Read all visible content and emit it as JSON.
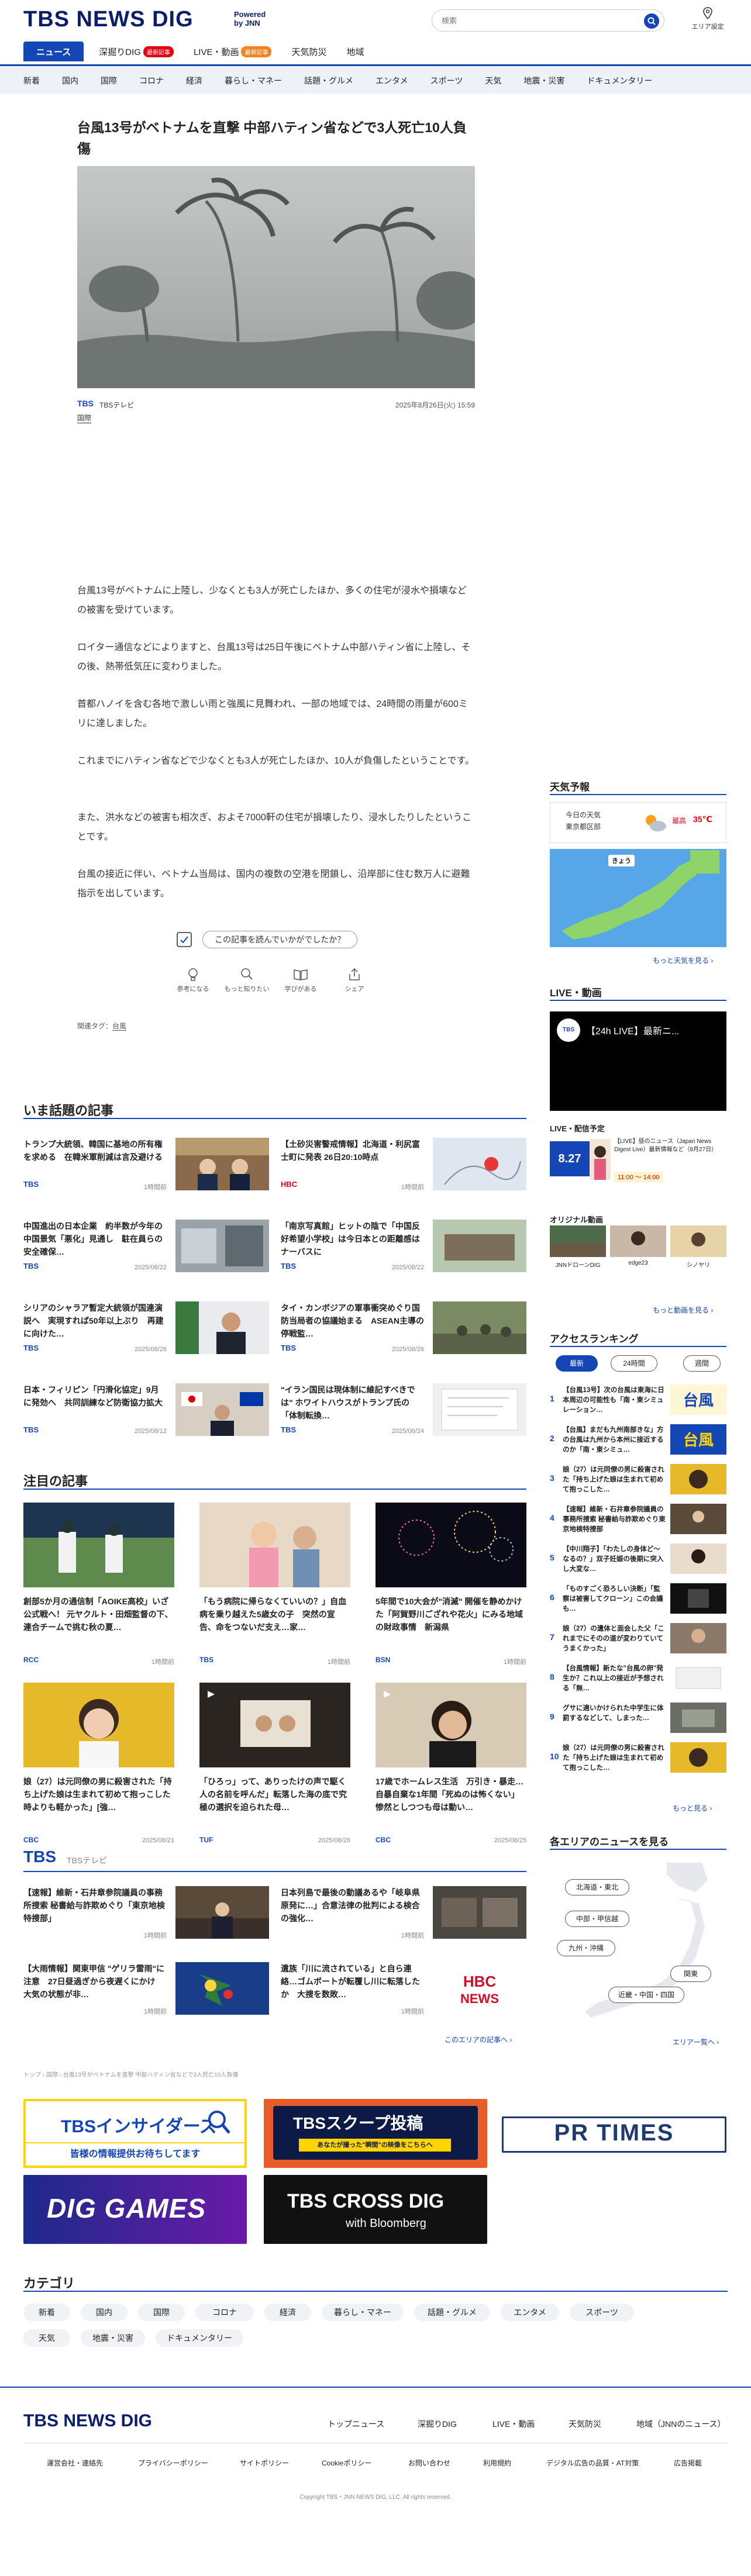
{
  "header": {
    "logo": "TBS NEWS DIG",
    "powered_line1": "Powered",
    "powered_line2": "by JNN",
    "search_placeholder": "検索",
    "area_label": "エリア設定",
    "nav": [
      {
        "label": "ニュース",
        "badge": ""
      },
      {
        "label": "深掘りDIG",
        "badge": "最新記事"
      },
      {
        "label": "LIVE・動画",
        "badge": "最新記事"
      },
      {
        "label": "天気防災",
        "badge": ""
      },
      {
        "label": "地域",
        "badge": ""
      }
    ],
    "subnav": [
      "新着",
      "国内",
      "国際",
      "コロナ",
      "経済",
      "暮らし・マネー",
      "話題・グルメ",
      "エンタメ",
      "スポーツ",
      "天気",
      "地震・災害",
      "ドキュメンタリー"
    ]
  },
  "article": {
    "title": "台風13号がベトナムを直撃 中部ハティン省などで3人死亡10人負傷",
    "source_logo": "TBS",
    "source_name": "TBSテレビ",
    "date": "2025年8月26日(火) 15:59",
    "category": "国際",
    "paragraphs": [
      "台風13号がベトナムに上陸し、少なくとも3人が死亡したほか、多くの住宅が浸水や損壊などの被害を受けています。",
      "ロイター通信などによりますと、台風13号は25日午後にベトナム中部ハティン省に上陸し、その後、熱帯低気圧に変わりました。",
      "首都ハノイを含む各地で激しい雨と強風に見舞われ、一部の地域では、24時間の雨量が600ミリに達しました。",
      "これまでにハティン省などで少なくとも3人が死亡したほか、10人が負傷したということです。",
      "また、洪水などの被害も相次ぎ、およそ7000軒の住宅が損壊したり、浸水したりしたということです。",
      "台風の接近に伴い、ベトナム当局は、国内の複数の空港を閉鎖し、沿岸部に住む数万人に避難指示を出しています。"
    ],
    "feedback_question": "この記事を読んでいかがでしたか？",
    "reactions": [
      "参考になる",
      "もっと知りたい",
      "学びがある",
      "シェア"
    ],
    "tags_label": "関連タグ：",
    "tag": "台風"
  },
  "trending": {
    "heading": "いま話題の記事",
    "items": [
      {
        "title": "トランプ大統領、韓国に基地の所有権を求める　在韓米軍削減は言及避ける",
        "src": "TBS",
        "time": "1時間前"
      },
      {
        "title": "【土砂災害警戒情報】北海道・利尻富士町に発表 26日20:10時点",
        "src": "HBC",
        "time": "1時間前"
      },
      {
        "title": "中国進出の日本企業　約半数が今年の中国景気「悪化」見通し　駐在員らの安全確保…",
        "src": "TBS",
        "time": "2025/08/22"
      },
      {
        "title": "「南京写真館」ヒットの陰で「中国反好希望小学校」は今日本との距離感はナーバスに",
        "src": "TBS",
        "time": "2025/08/22"
      },
      {
        "title": "シリアのシャラア暫定大統領が国連演説へ　実現すれば50年以上ぶり　再建に向けた…",
        "src": "TBS",
        "time": "2025/08/26"
      },
      {
        "title": "タイ・カンボジアの軍事衝突めぐり国防当局者の協議始まる　ASEAN主導の停戦監…",
        "src": "TBS",
        "time": "2025/08/26"
      },
      {
        "title": "日本・フィリピン「円滑化協定」9月に発効へ　共同訓練など防衛協力拡大",
        "src": "TBS",
        "time": "2025/08/12"
      },
      {
        "title": "\"イラン国民は現体制に維記すべきでは\" ホワイトハウスがトランプ氏の「体制転換…",
        "src": "TBS",
        "time": "2025/06/24"
      }
    ]
  },
  "attention": {
    "heading": "注目の記事",
    "items": [
      {
        "title": "創部5か月の通信制「AOIKE高校」いざ公式戦へ！ 元ヤクルト・田畑監督の下、連合チームで挑む秋の夏…",
        "src": "RCC",
        "time": "1時間前"
      },
      {
        "title": "「もう病院に帰らなくていいの？」自血病を乗り越えた5歳女の子　突然の宣告、命をつないだ支え…家…",
        "src": "TBS",
        "time": "1時間前"
      },
      {
        "title": "5年間で10大会が\"消滅\" 開催を静めかけた「阿賀野川ござれや花火」にみる地域の財政事情　新潟県",
        "src": "BSN",
        "time": "1時間前"
      },
      {
        "title": "娘（27）は元同僚の男に殺害された「持ち上げた娘は生まれて初めて抱っこした時よりも軽かった」[強…",
        "src": "CBC",
        "time": "2025/08/21"
      },
      {
        "title": "「ひろっ」って、ありったけの声で駆く人の名前を呼んだ」転落した海の底で究極の選択を迫られた母…",
        "src": "TUF",
        "time": "2025/08/26"
      },
      {
        "title": "17歳でホームレス生活　万引き・暴走…自暴自棄な1年間「死ぬのは怖くない」惨然としつつも母は動い…",
        "src": "CBC",
        "time": "2025/08/25"
      }
    ]
  },
  "tbs_section": {
    "logo": "TBS",
    "name": "TBSテレビ",
    "items": [
      {
        "title": "【速報】維新・石井章参院議員の事務所捜索 秘書給与詐欺めぐり「東京地検特捜部」",
        "time": "1時間前"
      },
      {
        "title": "日本列島で最後の動議あるや「岐阜県原発に…」合意法律の批判による検合の強化…",
        "time": "1時間前"
      },
      {
        "title": "【大雨情報】関東甲信 \"ゲリラ雷雨\"に注意　27日昼過ぎから夜遅くにかけ　大気の状態が非…",
        "time": "1時間前"
      },
      {
        "title": "遺族「川に流されている」と自ら連絡…ゴムボートが転覆し川に転落したか　大捜を数敗…",
        "time": "1時間前"
      }
    ],
    "more": "このエリアの記事へ ›"
  },
  "breadcrumb": "トップ › 国際 › 台風13号がベトナムを直撃 中部ハティン省などで3人死亡10人負傷",
  "banners": [
    {
      "title": "TBSインサイダーズ",
      "sub": "皆様の情報提供お待ちしてます"
    },
    {
      "title": "TBSスクープ投稿",
      "sub": "あなたが撮った\"瞬間\"の映像をこちらへ"
    },
    {
      "title": "PR TIMES",
      "sub": ""
    },
    {
      "title": "DIG GAMES",
      "sub": ""
    },
    {
      "title": "TBS CROSS DIG",
      "sub": "with Bloomberg"
    }
  ],
  "categories": {
    "heading": "カテゴリ",
    "items": [
      "新着",
      "国内",
      "国際",
      "コロナ",
      "経済",
      "暮らし・マネー",
      "話題・グルメ",
      "エンタメ",
      "スポーツ",
      "天気",
      "地震・災害",
      "ドキュメンタリー"
    ]
  },
  "sidebar": {
    "weather": {
      "heading": "天気予報",
      "today": "今日の天気",
      "region": "東京都区部",
      "high_label": "最高",
      "high": "35℃",
      "today_tag": "きょう",
      "more": "もっと天気を見る ›"
    },
    "live": {
      "heading": "LIVE・動画",
      "video_title": "【24h LIVE】最新ニ...",
      "schedule_heading": "LIVE・配信予定",
      "sched_date": "8.27",
      "sched_title": "【LIVE】昼のニュース（Japan News Digest Live）最新情報など（8月27日）",
      "sched_time": "11:00 〜 14:00",
      "original_heading": "オリジナル動画",
      "originals": [
        "JNNドローンDIG",
        "edge23",
        "シノヤリ"
      ],
      "more": "もっと動画を見る ›"
    },
    "ranking": {
      "heading": "アクセスランキング",
      "tabs": [
        "最新",
        "24時間",
        "週間"
      ],
      "items": [
        "【台風13号】次の台風は東海に日本周辺の可能性も「南・東シミュレーション…",
        "【台風】まだも九州南部きな」方の台風は九州から本州に接近するのか「南・東シミュ…",
        "娘（27）は元同僚の男に殺害された「持ち上げた娘は生まれて初めて抱っこした…",
        "【速報】維新・石井章参院議員の事務所捜索 秘書給与詐欺めぐり東京地検特捜部",
        "【中川翔子】「わたしの身体ど〜なるの？」双子妊娠の後期に突入し大変な…",
        "「ものすごく恐ろしい決断」「監察は被害してクローン」この会議も…",
        "娘（27）の遺体と面会した父「これまでにそのの道が変わりていてうまくかった」",
        "【台風情報】新たな\"台風の卵\"発生か？これ以上の接近が予想される「無…",
        "グサに適いかけられた中学生に体罰するなどして、しまった…",
        "娘（27）は元同僚の男に殺害された「持ち上げた娘は生まれて初めて抱っこした…"
      ],
      "more": "もっと見る ›"
    },
    "area": {
      "heading": "各エリアのニュースを見る",
      "regions": [
        "北海道・東北",
        "中部・甲信越",
        "九州・沖縄",
        "関東",
        "近畿・中国・四国"
      ],
      "more": "エリア一覧へ ›"
    }
  },
  "footer": {
    "logo": "TBS NEWS DIG",
    "links": [
      "トップニュース",
      "深掘りDIG",
      "LIVE・動画",
      "天気防災",
      "地域（JNNのニュース）"
    ],
    "sublinks": [
      "運営会社・連絡先",
      "プライバシーポリシー",
      "サイトポリシー",
      "Cookieポリシー",
      "お問い合わせ",
      "利用規約",
      "デジタル広告の品質・AT対策",
      "広告掲載"
    ],
    "copyright": "Copyright TBS・JNN NEWS DIG, LLC. All rights reserved."
  },
  "colors": {
    "brand": "#1546b6",
    "orange": "#f5821f",
    "red": "#e60012"
  }
}
